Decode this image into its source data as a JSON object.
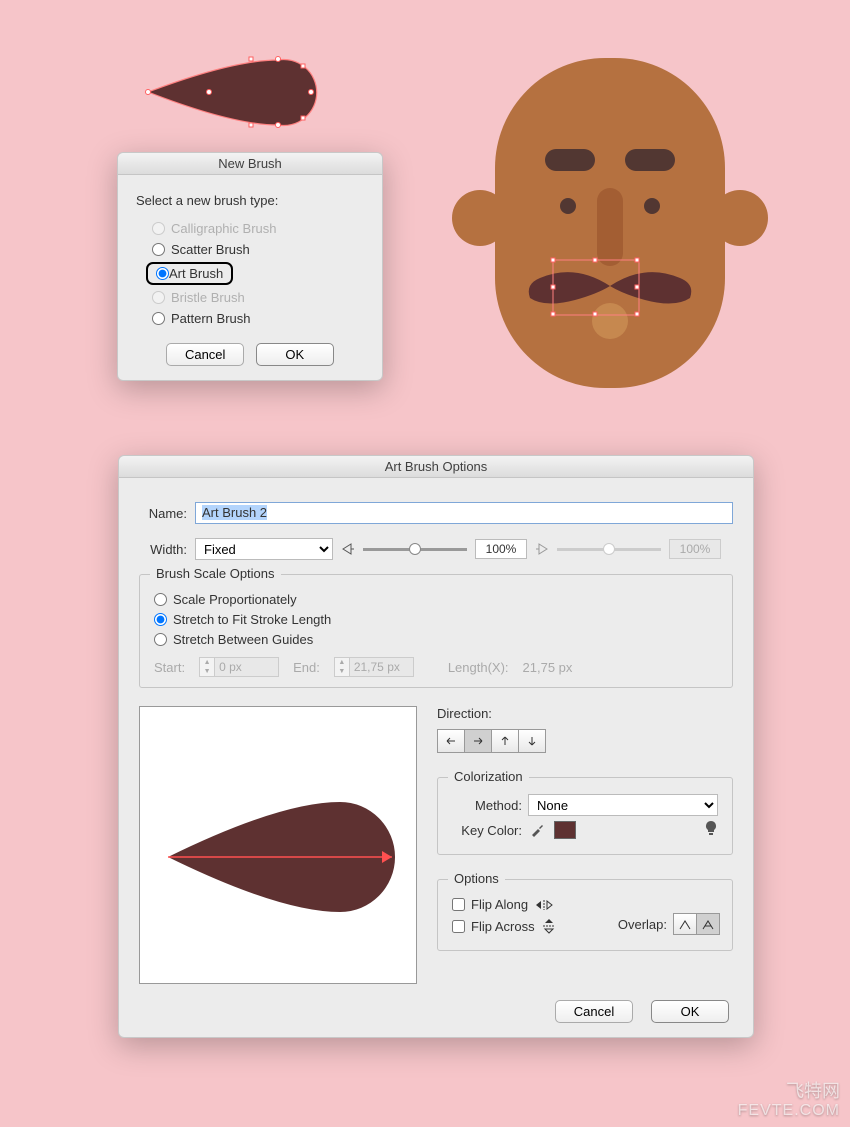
{
  "newBrush": {
    "title": "New Brush",
    "header": "Select a new brush type:",
    "options": {
      "calligraphic": "Calligraphic Brush",
      "scatter": "Scatter Brush",
      "art": "Art Brush",
      "bristle": "Bristle Brush",
      "pattern": "Pattern Brush"
    },
    "cancel": "Cancel",
    "ok": "OK"
  },
  "abo": {
    "title": "Art Brush Options",
    "nameLabel": "Name:",
    "nameValue": "Art Brush 2",
    "widthLabel": "Width:",
    "widthMode": "Fixed",
    "widthPct1": "100%",
    "widthPct2": "100%",
    "scale": {
      "legend": "Brush Scale Options",
      "prop": "Scale Proportionately",
      "stretch": "Stretch to Fit Stroke Length",
      "guides": "Stretch Between Guides",
      "startLabel": "Start:",
      "startVal": "0 px",
      "endLabel": "End:",
      "endVal": "21,75 px",
      "lenLabel": "Length(X):",
      "lenVal": "21,75 px"
    },
    "directionLabel": "Direction:",
    "colorize": {
      "legend": "Colorization",
      "methodLabel": "Method:",
      "methodValue": "None",
      "keyLabel": "Key Color:",
      "swatch": "#5e3131"
    },
    "options": {
      "legend": "Options",
      "flipAlong": "Flip Along",
      "flipAcross": "Flip Across",
      "overlapLabel": "Overlap:"
    },
    "cancel": "Cancel",
    "ok": "OK"
  },
  "watermark": {
    "l1": "飞特网",
    "l2": "FEVTE.COM"
  }
}
